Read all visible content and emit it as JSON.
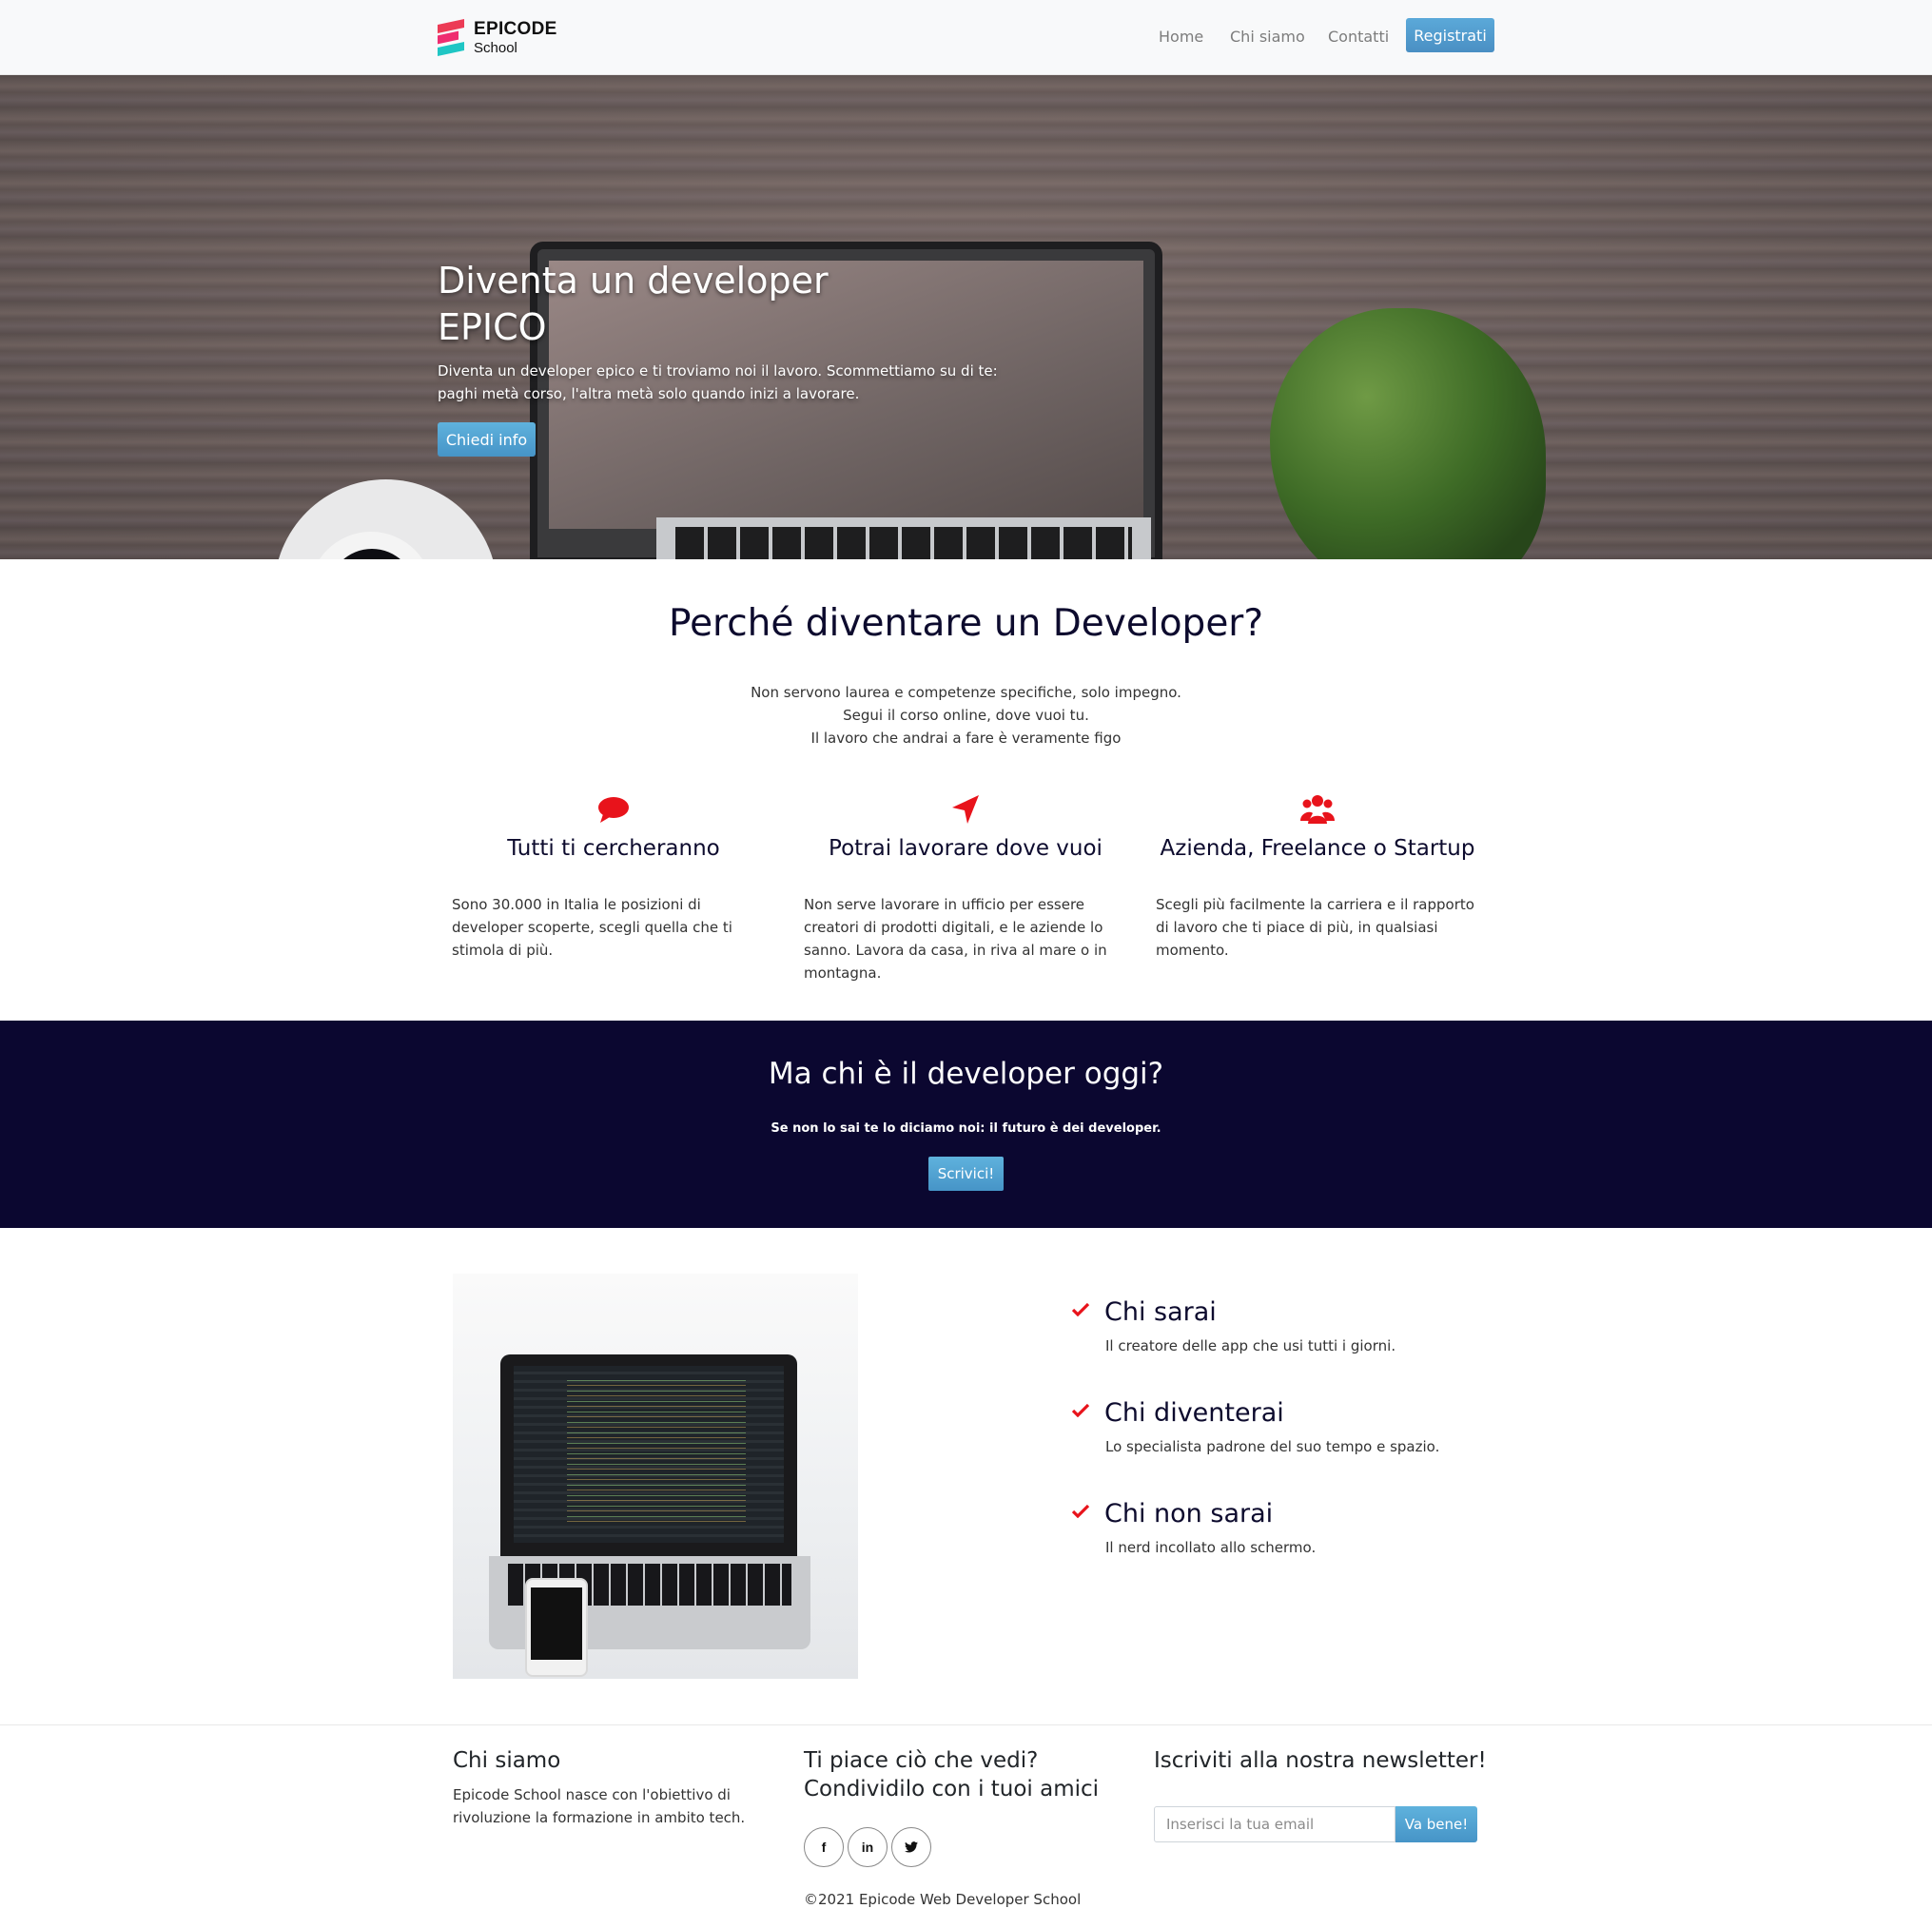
{
  "brand": {
    "title": "EPICODE",
    "subtitle": "School"
  },
  "nav": {
    "home": "Home",
    "chi_siamo": "Chi siamo",
    "contatti": "Contatti",
    "register": "Registrati"
  },
  "hero": {
    "title_line1": "Diventa un developer",
    "title_line2": "EPICO",
    "text_line1": "Diventa un developer epico e ti troviamo noi il lavoro. Scommettiamo su di te:",
    "text_line2": "paghi metà corso, l'altra metà solo quando inizi a lavorare.",
    "button": "Chiedi info"
  },
  "why": {
    "title": "Perché diventare un Developer?",
    "line1": "Non servono laurea e competenze specifiche, solo impegno.",
    "line2": "Segui il corso online, dove vuoi tu.",
    "line3": "Il lavoro che andrai a fare è veramente figo",
    "features": [
      {
        "icon": "speech-bubble-icon",
        "title": "Tutti ti cercheranno",
        "text": "Sono 30.000 in Italia le posizioni di developer scoperte, scegli quella che ti stimola di più."
      },
      {
        "icon": "location-arrow-icon",
        "title": "Potrai lavorare dove vuoi",
        "text": "Non serve lavorare in ufficio per essere creatori di prodotti digitali, e le aziende lo sanno. Lavora da casa, in riva al mare o in montagna."
      },
      {
        "icon": "users-icon",
        "title": "Azienda, Freelance o Startup",
        "text": "Scegli più facilmente la carriera e il rapporto di lavoro che ti piace di più, in qualsiasi momento."
      }
    ]
  },
  "band": {
    "title": "Ma chi è il developer oggi?",
    "subtitle": "Se non lo sai te lo diciamo noi: il futuro è dei developer.",
    "button": "Scrivici!"
  },
  "checks": [
    {
      "title": "Chi sarai",
      "text": "Il creatore delle app che usi tutti i giorni."
    },
    {
      "title": "Chi diventerai",
      "text": "Lo specialista padrone del suo tempo e spazio."
    },
    {
      "title": "Chi non sarai",
      "text": "Il nerd incollato allo schermo."
    }
  ],
  "footer": {
    "about_title": "Chi siamo",
    "about_text": "Epicode School nasce con l'obiettivo di rivoluzione la formazione in ambito tech.",
    "share_title_line1": "Ti piace ciò che vedi?",
    "share_title_line2": "Condividilo con i tuoi amici",
    "socials": [
      "f",
      "in",
      "t"
    ],
    "newsletter_title": "Iscriviti alla nostra newsletter!",
    "newsletter_placeholder": "Inserisci la tua email",
    "newsletter_button": "Va bene!",
    "copyright": "©2021 Epicode Web Developer School"
  },
  "colors": {
    "accent_red": "#e8131b",
    "navy": "#0b0730",
    "button_blue": "#4f9dd0"
  }
}
